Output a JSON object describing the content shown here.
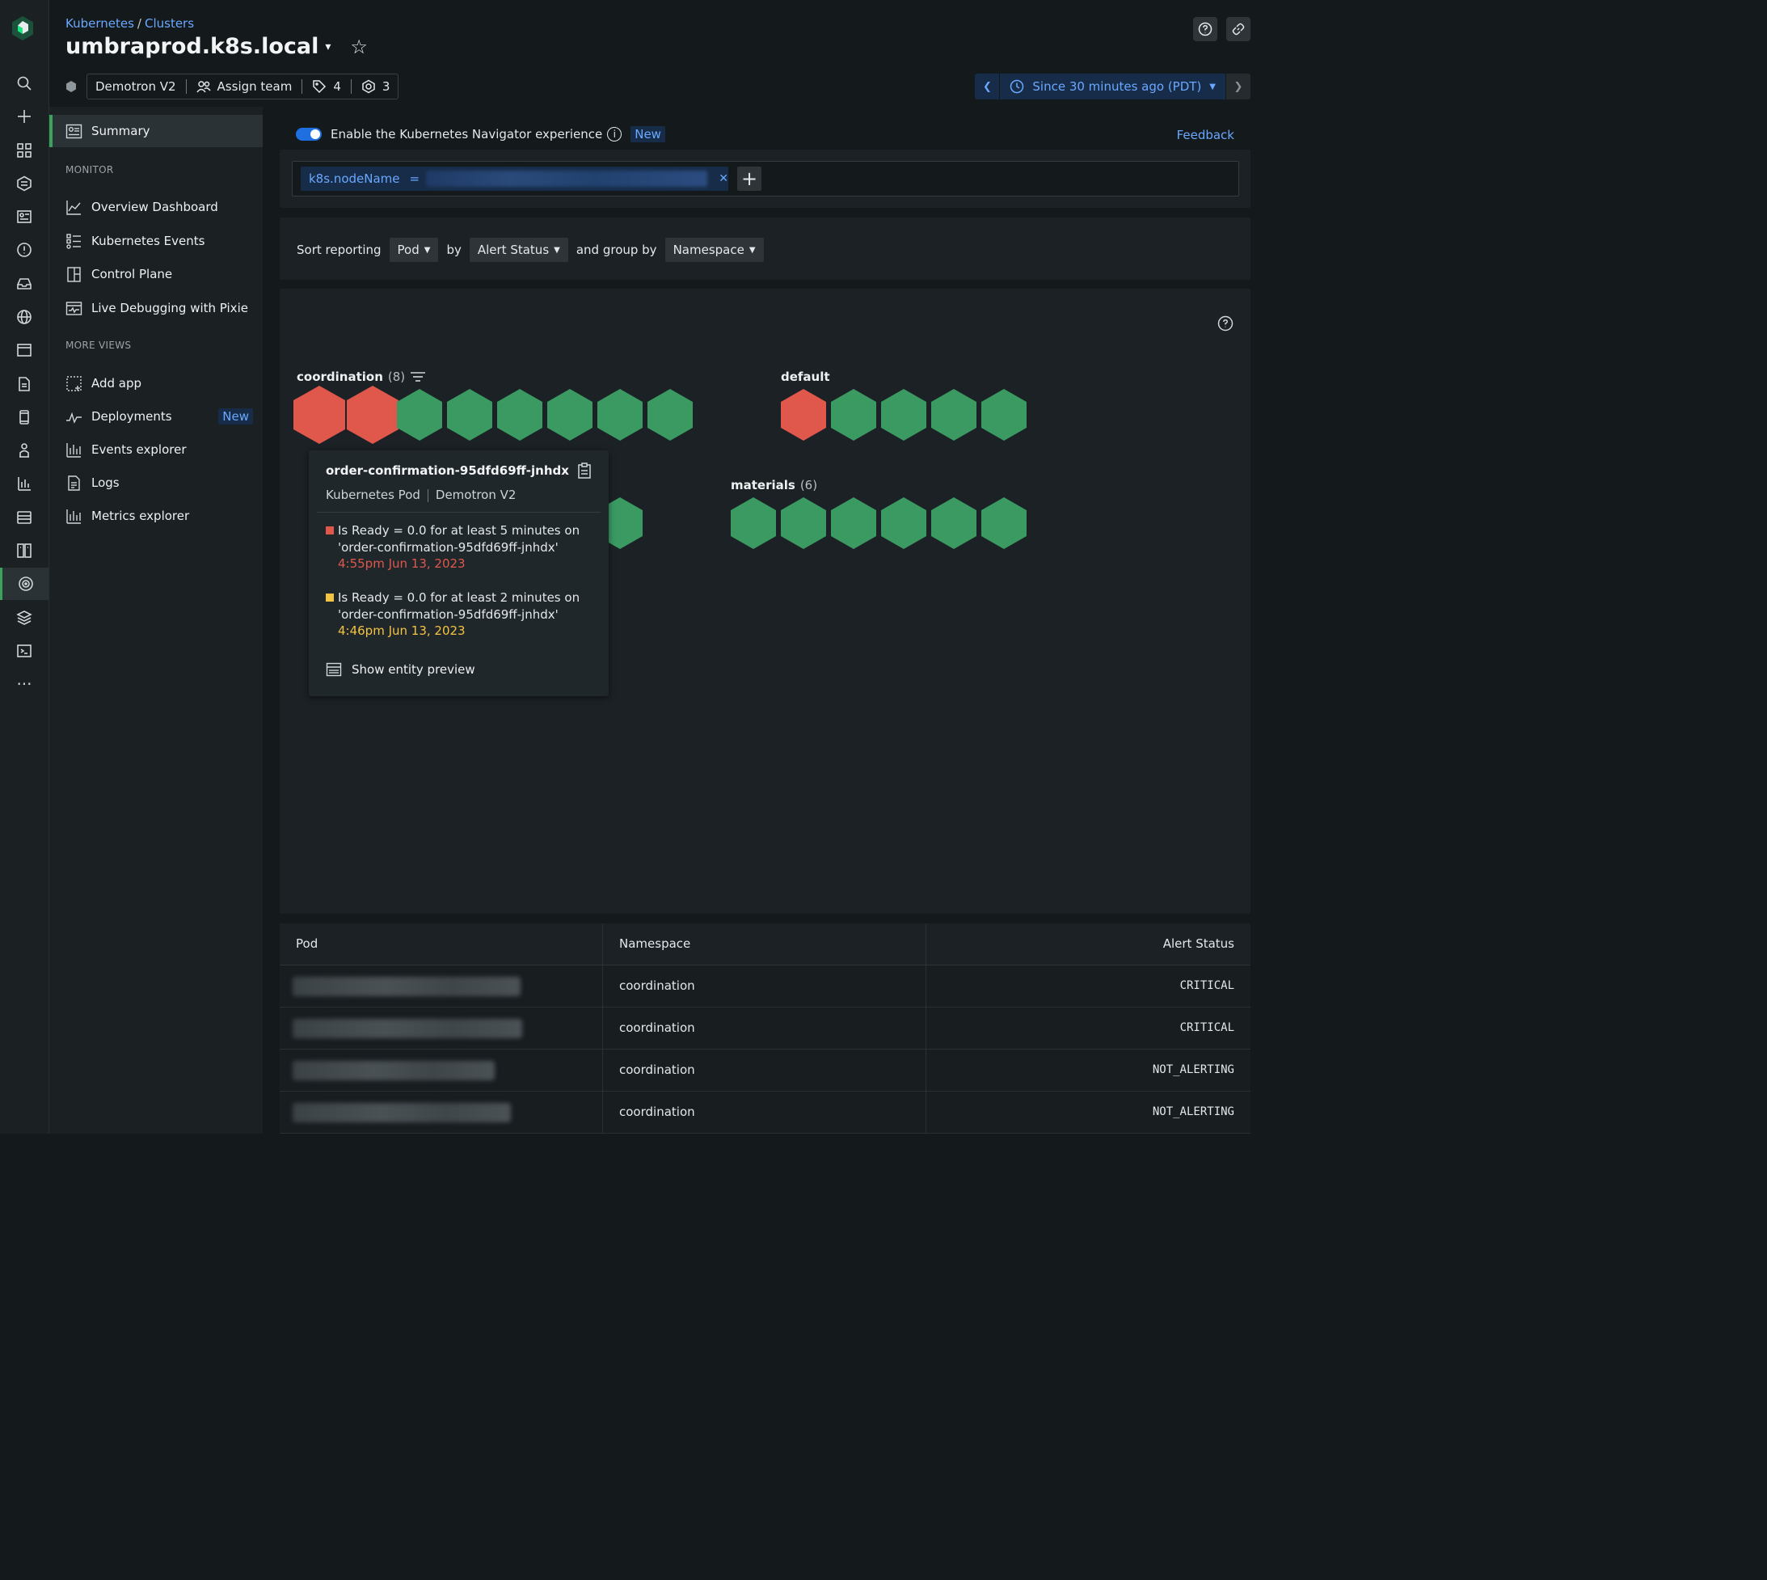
{
  "breadcrumb": {
    "root": "Kubernetes",
    "separator": "/",
    "child": "Clusters"
  },
  "header": {
    "title": "umbraprod.k8s.local",
    "account": "Demotron V2",
    "assign_team": "Assign team",
    "tags_count": "4",
    "related_count": "3"
  },
  "timepicker": {
    "label": "Since 30 minutes ago (PDT)"
  },
  "rail": [
    "search",
    "add",
    "apps",
    "apm",
    "dashboards",
    "alerts",
    "inbox",
    "browser",
    "mobile",
    "logs",
    "infra",
    "synthetics",
    "metrics",
    "entity-explorer",
    "errors-inbox",
    "kubernetes",
    "layers",
    "terminal",
    "more"
  ],
  "sidebar": {
    "summary": "Summary",
    "monitor_header": "MONITOR",
    "monitor_items": [
      "Overview Dashboard",
      "Kubernetes Events",
      "Control Plane",
      "Live Debugging with Pixie"
    ],
    "more_header": "MORE VIEWS",
    "more_items": [
      "Add app",
      "Deployments",
      "Events explorer",
      "Logs",
      "Metrics explorer"
    ],
    "new_badge": "New"
  },
  "navigator": {
    "toggle_label": "Enable the Kubernetes Navigator experience",
    "new_badge": "New",
    "feedback": "Feedback"
  },
  "filter": {
    "key": "k8s.nodeName",
    "operator": "="
  },
  "sort": {
    "prefix": "Sort reporting",
    "entity": "Pod",
    "by": "by",
    "metric": "Alert Status",
    "group_prefix": "and group by",
    "group": "Namespace"
  },
  "groups": [
    {
      "name": "coordination",
      "count": "(8)",
      "statuses": [
        "critical",
        "critical",
        "ok",
        "ok",
        "ok",
        "ok",
        "ok",
        "ok"
      ]
    },
    {
      "name": "default",
      "count": "",
      "statuses": [
        "critical",
        "ok",
        "ok",
        "ok",
        "ok"
      ]
    },
    {
      "name": "materials",
      "count": "(6)",
      "statuses": [
        "ok",
        "ok",
        "ok",
        "ok",
        "ok",
        "ok"
      ]
    }
  ],
  "colors": {
    "critical": "#e0574c",
    "warning": "#f5c342",
    "ok": "#3a9a62",
    "accent": "#6aa8ff"
  },
  "tooltip": {
    "title": "order-confirmation-95dfd69ff-jnhdx",
    "type": "Kubernetes Pod",
    "account": "Demotron V2",
    "alerts": [
      {
        "severity": "critical",
        "line1": "Is Ready = 0.0 for at least 5 minutes on",
        "line2": "'order-confirmation-95dfd69ff-jnhdx'",
        "time": "4:55pm Jun 13, 2023"
      },
      {
        "severity": "warning",
        "line1": "Is Ready = 0.0 for at least 2 minutes on",
        "line2": "'order-confirmation-95dfd69ff-jnhdx'",
        "time": "4:46pm Jun 13, 2023"
      }
    ],
    "show_preview": "Show entity preview"
  },
  "table": {
    "columns": [
      "Pod",
      "Namespace",
      "Alert Status"
    ],
    "rows": [
      {
        "namespace": "coordination",
        "status": "CRITICAL"
      },
      {
        "namespace": "coordination",
        "status": "CRITICAL"
      },
      {
        "namespace": "coordination",
        "status": "NOT_ALERTING"
      },
      {
        "namespace": "coordination",
        "status": "NOT_ALERTING"
      }
    ]
  }
}
